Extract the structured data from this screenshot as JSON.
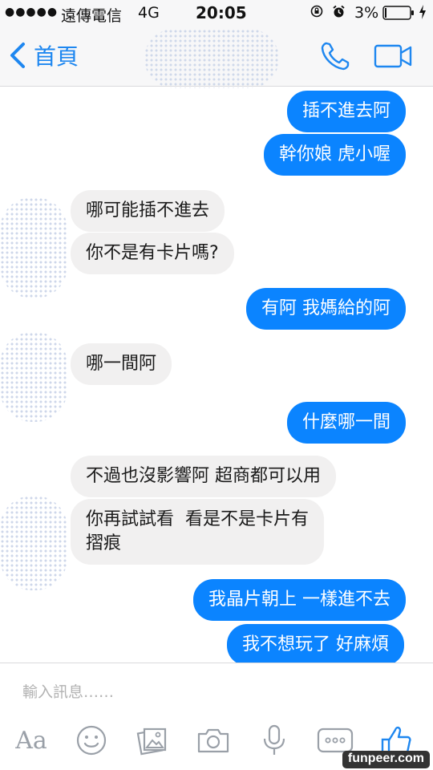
{
  "status_bar": {
    "signal": "●●●●●",
    "carrier": "遠傳電信",
    "network": "4G",
    "time": "20:05",
    "battery": "3%"
  },
  "header": {
    "back_label": "首頁"
  },
  "colors": {
    "accent": "#1e87f0",
    "outgoing_bubble": "#0b84ff",
    "incoming_bubble": "#f1f0f0"
  },
  "messages": [
    {
      "direction": "outgoing",
      "text": "插不進去阿"
    },
    {
      "direction": "outgoing",
      "text": "幹你娘 虎小喔"
    },
    {
      "direction": "incoming",
      "text": "哪可能插不進去"
    },
    {
      "direction": "incoming",
      "text": "你不是有卡片嗎?"
    },
    {
      "direction": "outgoing",
      "text": "有阿 我媽給的阿"
    },
    {
      "direction": "incoming",
      "text": "哪一間阿"
    },
    {
      "direction": "outgoing",
      "text": "什麼哪一間"
    },
    {
      "direction": "incoming",
      "text": "不過也沒影響阿 超商都可以用"
    },
    {
      "direction": "incoming",
      "text": "你再試試看  看是不是卡片有\n摺痕"
    },
    {
      "direction": "outgoing",
      "text": "我晶片朝上 一樣進不去"
    },
    {
      "direction": "outgoing",
      "text": "我不想玩了 好麻煩"
    }
  ],
  "composer": {
    "placeholder": "輸入訊息……",
    "text_format_label": "Aa",
    "icons": [
      "text-format-icon",
      "emoji-icon",
      "photo-gallery-icon",
      "camera-icon",
      "microphone-icon",
      "more-options-icon",
      "like-icon"
    ]
  },
  "watermark": "funpeer.com"
}
